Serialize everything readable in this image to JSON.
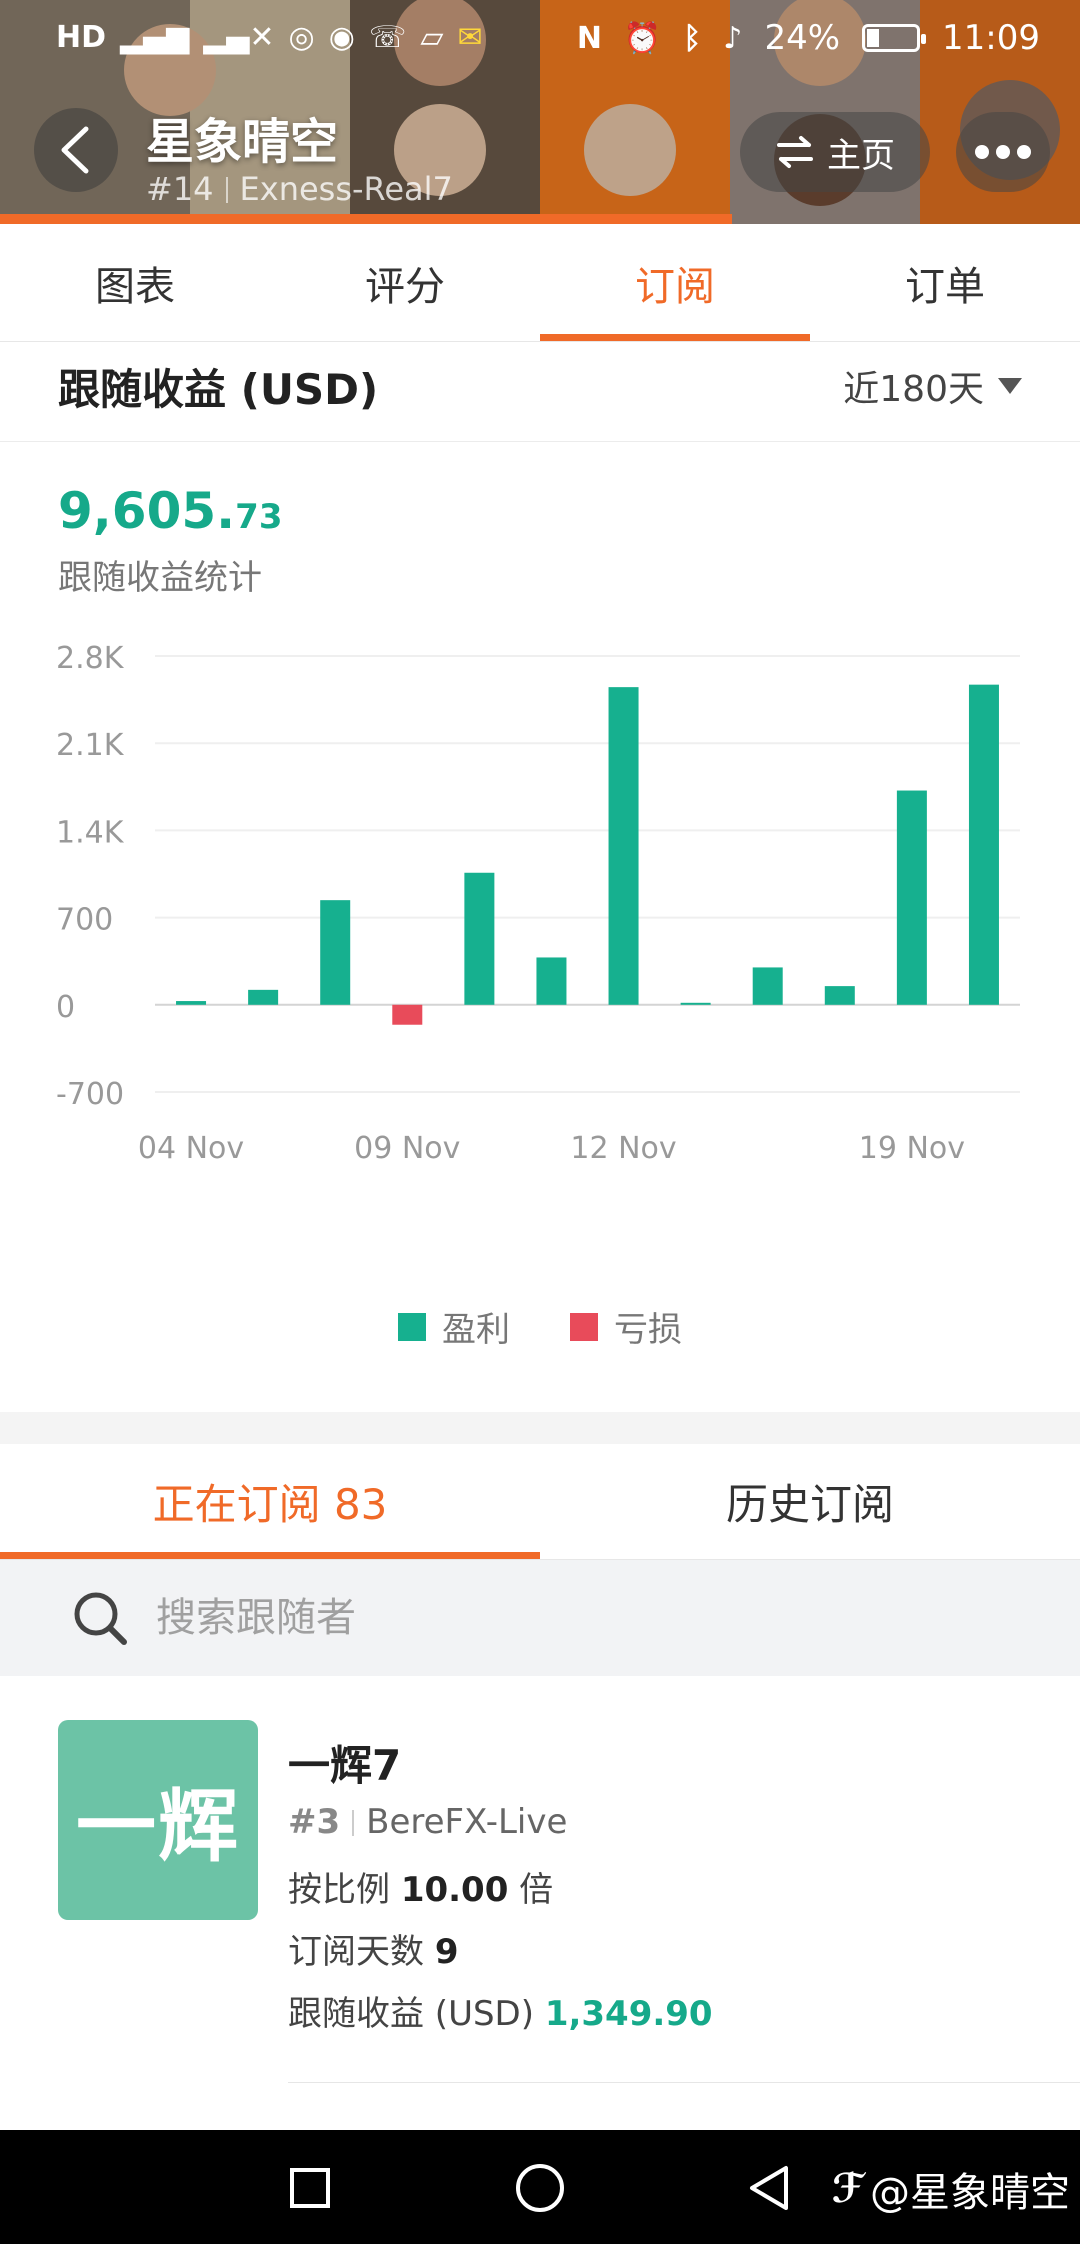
{
  "statusbar": {
    "left_icons": [
      "hd-icon",
      "signal-4g-icon",
      "signal-no-service-icon",
      "hotspot-icon",
      "eye-icon",
      "missed-call-icon",
      "box-icon",
      "message-icon"
    ],
    "right_icons": [
      "nfc-icon",
      "alarm-icon",
      "bluetooth-icon",
      "mute-icon"
    ],
    "battery": "24%",
    "time": "11:09"
  },
  "header": {
    "title": "星象晴空",
    "rank": "#14",
    "account": "Exness-Real7",
    "home_label": "主页",
    "accent_color": "#f06a28"
  },
  "tabs": [
    {
      "label": "图表",
      "active": false
    },
    {
      "label": "评分",
      "active": false
    },
    {
      "label": "订阅",
      "active": true
    },
    {
      "label": "订单",
      "active": false
    }
  ],
  "section": {
    "title": "跟随收益 (USD)",
    "period": "近180天"
  },
  "stats": {
    "total_int": "9,605.",
    "total_dec": "73",
    "label": "跟随收益统计"
  },
  "chart_data": {
    "type": "bar",
    "ylim": [
      -700,
      2800
    ],
    "yticks": [
      "2.8K",
      "2.1K",
      "1.4K",
      "700",
      "0",
      "-700"
    ],
    "ytick_values": [
      2800,
      2100,
      1400,
      700,
      0,
      -700
    ],
    "xtick_labels": [
      "04 Nov",
      "09 Nov",
      "12 Nov",
      "19 Nov"
    ],
    "xtick_bar_index": [
      0,
      3,
      6,
      10
    ],
    "values": [
      30,
      120,
      840,
      -160,
      1060,
      380,
      2550,
      5,
      300,
      150,
      1720,
      2570
    ],
    "legend": [
      {
        "name": "盈利",
        "color": "#16b08f"
      },
      {
        "name": "亏损",
        "color": "#e84b5a"
      }
    ]
  },
  "subscriptions": {
    "tabs": [
      {
        "label": "正在订阅 83",
        "active": true
      },
      {
        "label": "历史订阅",
        "active": false
      }
    ],
    "search_placeholder": "搜索跟随者"
  },
  "follower": {
    "avatar_text": "一辉",
    "name": "一辉7",
    "rank": "#3",
    "broker": "BereFX-Live",
    "ratio_prefix": "按比例",
    "ratio_value": "10.00",
    "ratio_suffix": "倍",
    "days_label": "订阅天数",
    "days_value": "9",
    "profit_label": "跟随收益 (USD)",
    "profit_value": "1,349.90"
  },
  "navbar": {
    "watermark": "@星象晴空"
  }
}
